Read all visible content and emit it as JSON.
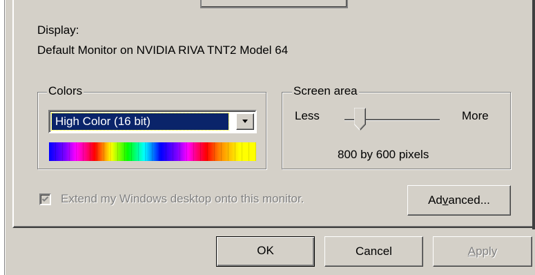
{
  "display": {
    "label": "Display:",
    "monitor": "Default Monitor on NVIDIA RIVA TNT2 Model 64"
  },
  "colors": {
    "title": "Colors",
    "selected": "High Color (16 bit)",
    "dropdown_icon": "chevron-down-icon"
  },
  "screen_area": {
    "title": "Screen area",
    "less_label": "Less",
    "more_label": "More",
    "resolution": "800 by 600 pixels"
  },
  "extend_desktop": {
    "label": "Extend my Windows desktop onto this monitor.",
    "checked": true,
    "enabled": false
  },
  "buttons": {
    "advanced_pre": "Ad",
    "advanced_mnemonic": "v",
    "advanced_post": "anced...",
    "ok": "OK",
    "cancel": "Cancel",
    "apply_mnemonic": "A",
    "apply_post": "pply"
  },
  "colors_palette": {
    "dialog_bg": "#d4d0c8",
    "selection_bg": "#0a246a",
    "disabled_text": "#808080"
  }
}
